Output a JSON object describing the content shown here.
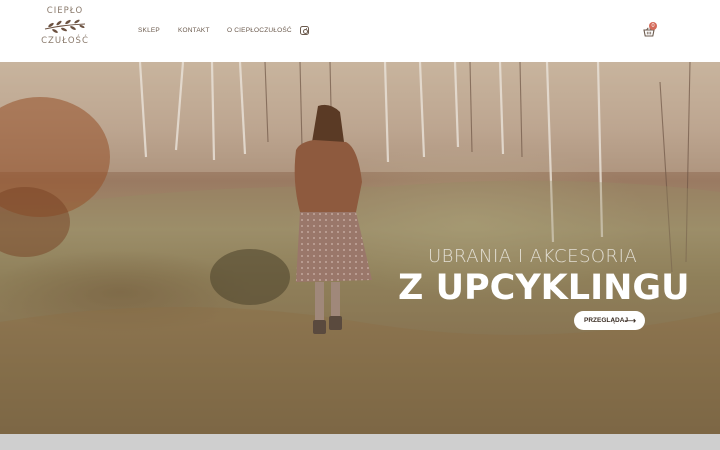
{
  "logo": {
    "line1": "CIEPŁO",
    "line2": "CZUŁOŚĆ"
  },
  "nav": {
    "items": [
      "SKLEP",
      "KONTAKT",
      "O CIEPŁOCZUŁOŚĆ"
    ]
  },
  "icons": {
    "social": "instagram-icon",
    "cart": "basket-icon"
  },
  "cart": {
    "count": "0"
  },
  "hero": {
    "subtitle": "UBRANIA I AKCESORIA",
    "title": "Z UPCYKLINGU",
    "button_label": "PRZEGLĄDAJ",
    "button_arrow": "⟶"
  },
  "colors": {
    "accent": "#d46a5a",
    "text": "#6b5a4d",
    "band": "#cfcfcf"
  }
}
